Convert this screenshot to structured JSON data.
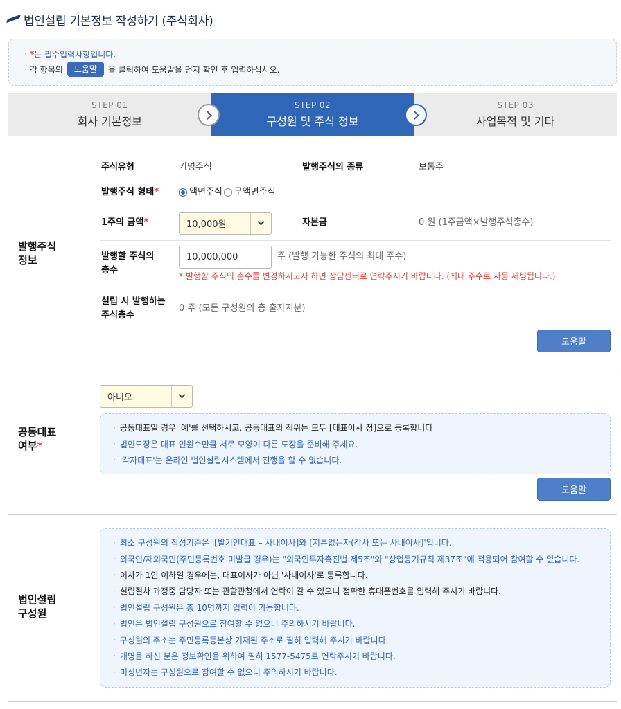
{
  "page": {
    "title": "법인설립 기본정보 작성하기 (주식회사)"
  },
  "notice": {
    "line1_mark": "*",
    "line1_text": "는 필수입력사항입니다.",
    "line2_before": "각 항목의",
    "line2_button": "도움말",
    "line2_after": "을 클릭하여 도움말을 먼저 확인 후 입력하십시오."
  },
  "steps": [
    {
      "num": "STEP 01",
      "name": "회사 기본정보"
    },
    {
      "num": "STEP 02",
      "name": "구성원 및 주식 정보"
    },
    {
      "num": "STEP 03",
      "name": "사업목적 및 기타"
    }
  ],
  "shares": {
    "section_label_1": "발행주식",
    "section_label_2": "정보",
    "stock_type_label": "주식유형",
    "stock_type_value": "기명주식",
    "issue_kind_label": "발행주식의 종류",
    "issue_kind_value": "보통주",
    "form_label": "발행주식 형태",
    "form_options": [
      "액면주식",
      "무액면주식"
    ],
    "par_label": "1주의 금액",
    "par_selected": "10,000원",
    "capital_label": "자본금",
    "capital_value": "0 원 (1주금액×발행주식총수)",
    "total_label_1": "발행할 주식의",
    "total_label_2": "총수",
    "total_value": "10,000,000",
    "total_unit": "주 (발행 가능한 주식의 최대 주수)",
    "total_warning": "* 발행할 주식의 총수를 변경하시고자 하면 상담센터로 연락주시기 바랍니다. (최대 주수로 자동 세팅됩니다.)",
    "at_est_label_1": "설립 시 발행하는",
    "at_est_label_2": "주식총수",
    "at_est_value": "0 주 (모든 구성원의 총 출자지분)",
    "help": "도움말"
  },
  "joint": {
    "section_label_1": "공동대표",
    "section_label_2": "여부",
    "selected": "아니오",
    "info": [
      "공동대표일 경우 '예'를 선택하시고, 공동대표의 직위는 모두 [대표이사 정]으로 등록합니다",
      "법인도장은 대표 인원수만큼 서로 모양이 다른 도장을 준비해 주세요.",
      "'각자대표'는 온라인 법인설립시스템에서 진행을 할 수 없습니다."
    ],
    "help": "도움말"
  },
  "members": {
    "section_label_1": "법인설립",
    "section_label_2": "구성원",
    "info": [
      "최소 구성원의 작성기준은 '[발기인대표 – 사내이사]와 [지분없는자(감사 또는 사내이사]'입니다.",
      "외국인/재외국민(주민등록번호 미발급 경우)는 \"외국인투자촉진법 제5조\"와 \"상업등기규칙 제37조\"에 적용되어 참여할 수 없습니다.",
      "이사가 1인 이하일 경우에는, 대표이사가 아닌 '사내이사'로 등록합니다.",
      "설립절차 과정중 담당자 또는 관할관청에서 연락이 갈 수 있으니 정확한 휴대폰번호를 입력해 주시기 바랍니다.",
      "법인설립 구성원은 총 10명까지 입력이 가능합니다.",
      "법인은 법인설립 구성원으로 참여할 수 없으니 주의하시기 바랍니다.",
      "구성원의 주소는 주민등록등본상 기재된 주소로 필히 입력해 주시기 바랍니다.",
      "개명을 하신 분은 정보확인을 위하여 필히 1577-5475로 연락주시기 바랍니다.",
      "미성년자는 구성원으로 참여할 수 없으니 주의하시기 바랍니다."
    ]
  }
}
